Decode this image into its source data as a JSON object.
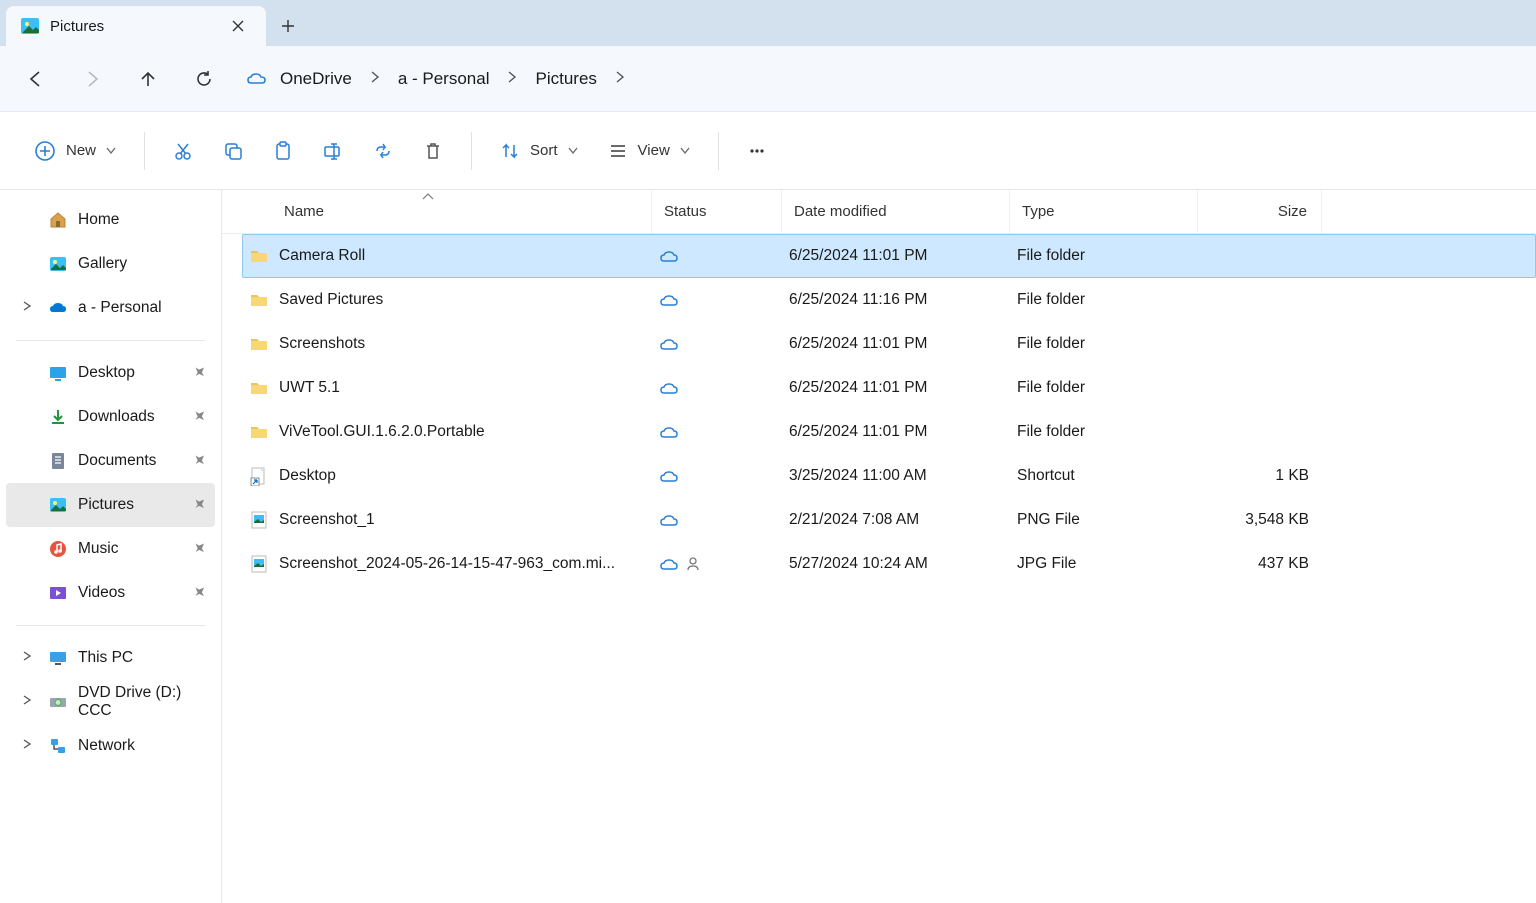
{
  "tab": {
    "title": "Pictures"
  },
  "breadcrumb": [
    "OneDrive",
    "a - Personal",
    "Pictures"
  ],
  "toolbar": {
    "new": "New",
    "sort": "Sort",
    "view": "View"
  },
  "columns": {
    "name": "Name",
    "status": "Status",
    "date": "Date modified",
    "type": "Type",
    "size": "Size"
  },
  "sidebar": {
    "top": [
      {
        "label": "Home",
        "icon": "home",
        "expandable": false
      },
      {
        "label": "Gallery",
        "icon": "gallery",
        "expandable": false
      },
      {
        "label": "a - Personal",
        "icon": "onedrive",
        "expandable": true
      }
    ],
    "pinned": [
      {
        "label": "Desktop",
        "icon": "desktop"
      },
      {
        "label": "Downloads",
        "icon": "downloads"
      },
      {
        "label": "Documents",
        "icon": "documents"
      },
      {
        "label": "Pictures",
        "icon": "pictures",
        "selected": true
      },
      {
        "label": "Music",
        "icon": "music"
      },
      {
        "label": "Videos",
        "icon": "videos"
      }
    ],
    "bottom": [
      {
        "label": "This PC",
        "icon": "thispc",
        "expandable": true
      },
      {
        "label": "DVD Drive (D:) CCC",
        "icon": "dvd",
        "expandable": true
      },
      {
        "label": "Network",
        "icon": "network",
        "expandable": true
      }
    ]
  },
  "files": [
    {
      "name": "Camera Roll",
      "icon": "folder",
      "status": "cloud",
      "date": "6/25/2024 11:01 PM",
      "type": "File folder",
      "size": "",
      "selected": true
    },
    {
      "name": "Saved Pictures",
      "icon": "folder",
      "status": "cloud",
      "date": "6/25/2024 11:16 PM",
      "type": "File folder",
      "size": ""
    },
    {
      "name": "Screenshots",
      "icon": "folder",
      "status": "cloud",
      "date": "6/25/2024 11:01 PM",
      "type": "File folder",
      "size": ""
    },
    {
      "name": "UWT 5.1",
      "icon": "folder",
      "status": "cloud",
      "date": "6/25/2024 11:01 PM",
      "type": "File folder",
      "size": ""
    },
    {
      "name": "ViVeTool.GUI.1.6.2.0.Portable",
      "icon": "folder",
      "status": "cloud",
      "date": "6/25/2024 11:01 PM",
      "type": "File folder",
      "size": ""
    },
    {
      "name": "Desktop",
      "icon": "shortcut",
      "status": "cloud",
      "date": "3/25/2024 11:00 AM",
      "type": "Shortcut",
      "size": "1 KB"
    },
    {
      "name": "Screenshot_1",
      "icon": "image",
      "status": "cloud",
      "date": "2/21/2024 7:08 AM",
      "type": "PNG File",
      "size": "3,548 KB"
    },
    {
      "name": "Screenshot_2024-05-26-14-15-47-963_com.mi...",
      "icon": "image",
      "status": "cloud-shared",
      "date": "5/27/2024 10:24 AM",
      "type": "JPG File",
      "size": "437 KB"
    }
  ]
}
